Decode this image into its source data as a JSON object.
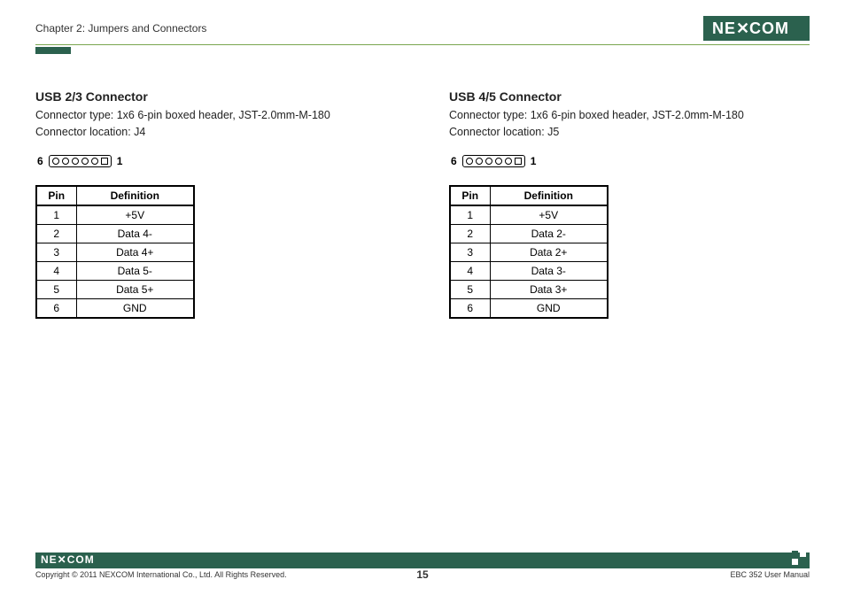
{
  "header": {
    "chapter": "Chapter 2: Jumpers and Connectors",
    "logo_text": "NE COM"
  },
  "left": {
    "title": "USB 2/3 Connector",
    "desc_line1": "Connector type: 1x6 6-pin boxed header,  JST-2.0mm-M-180",
    "desc_line2": "Connector location: J4",
    "pin_left": "6",
    "pin_right": "1",
    "table": {
      "h1": "Pin",
      "h2": "Definition",
      "rows": [
        {
          "pin": "1",
          "def": "+5V"
        },
        {
          "pin": "2",
          "def": "Data 4-"
        },
        {
          "pin": "3",
          "def": "Data 4+"
        },
        {
          "pin": "4",
          "def": "Data 5-"
        },
        {
          "pin": "5",
          "def": "Data 5+"
        },
        {
          "pin": "6",
          "def": "GND"
        }
      ]
    }
  },
  "right": {
    "title": "USB 4/5 Connector",
    "desc_line1": "Connector type: 1x6 6-pin boxed header,  JST-2.0mm-M-180",
    "desc_line2": "Connector location: J5",
    "pin_left": "6",
    "pin_right": "1",
    "table": {
      "h1": "Pin",
      "h2": "Definition",
      "rows": [
        {
          "pin": "1",
          "def": "+5V"
        },
        {
          "pin": "2",
          "def": "Data 2-"
        },
        {
          "pin": "3",
          "def": "Data 2+"
        },
        {
          "pin": "4",
          "def": "Data 3-"
        },
        {
          "pin": "5",
          "def": "Data 3+"
        },
        {
          "pin": "6",
          "def": "GND"
        }
      ]
    }
  },
  "footer": {
    "logo": "NE COM",
    "copyright": "Copyright © 2011 NEXCOM International Co., Ltd. All Rights Reserved.",
    "page": "15",
    "manual": "EBC 352 User Manual"
  }
}
